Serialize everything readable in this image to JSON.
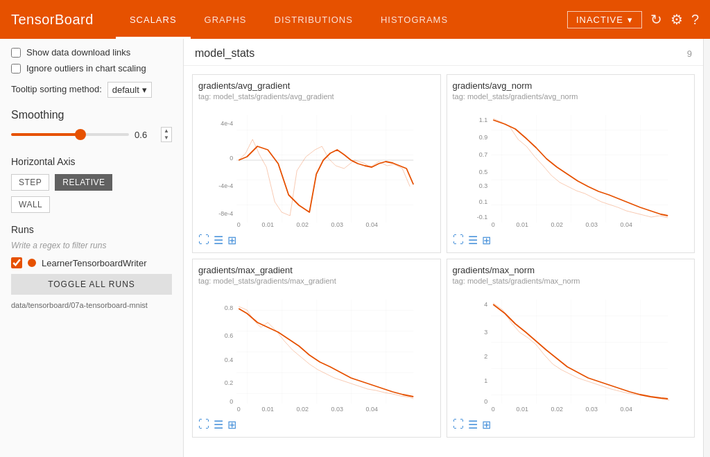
{
  "header": {
    "logo": "TensorBoard",
    "nav": [
      {
        "label": "SCALARS",
        "active": true
      },
      {
        "label": "GRAPHS",
        "active": false
      },
      {
        "label": "DISTRIBUTIONS",
        "active": false
      },
      {
        "label": "HISTOGRAMS",
        "active": false
      }
    ],
    "status": "INACTIVE",
    "icons": [
      "refresh-icon",
      "settings-icon",
      "help-icon"
    ]
  },
  "sidebar": {
    "show_data_links_label": "Show data download links",
    "ignore_outliers_label": "Ignore outliers in chart scaling",
    "tooltip_label": "Tooltip sorting method:",
    "tooltip_value": "default",
    "smoothing_label": "Smoothing",
    "smoothing_value": "0.6",
    "horizontal_axis_label": "Horizontal Axis",
    "axis_buttons": [
      {
        "label": "STEP",
        "active": false
      },
      {
        "label": "RELATIVE",
        "active": true
      },
      {
        "label": "WALL",
        "active": false
      }
    ],
    "runs_label": "Runs",
    "runs_filter_placeholder": "Write a regex to filter runs",
    "run_items": [
      {
        "name": "LearnerTensorboardWriter",
        "checked": true
      }
    ],
    "toggle_runs_label": "TOGGLE ALL RUNS",
    "run_path": "data/tensorboard/07a-tensorboard-mnist"
  },
  "main": {
    "section_name": "model_stats",
    "section_count": "9",
    "charts": [
      {
        "title": "gradients/avg_gradient",
        "tag": "tag: model_stats/gradients/avg_gradient"
      },
      {
        "title": "gradients/avg_norm",
        "tag": "tag: model_stats/gradients/avg_norm"
      },
      {
        "title": "gradients/max_gradient",
        "tag": "tag: model_stats/gradients/max_gradient"
      },
      {
        "title": "gradients/max_norm",
        "tag": "tag: model_stats/gradients/max_norm"
      }
    ]
  }
}
